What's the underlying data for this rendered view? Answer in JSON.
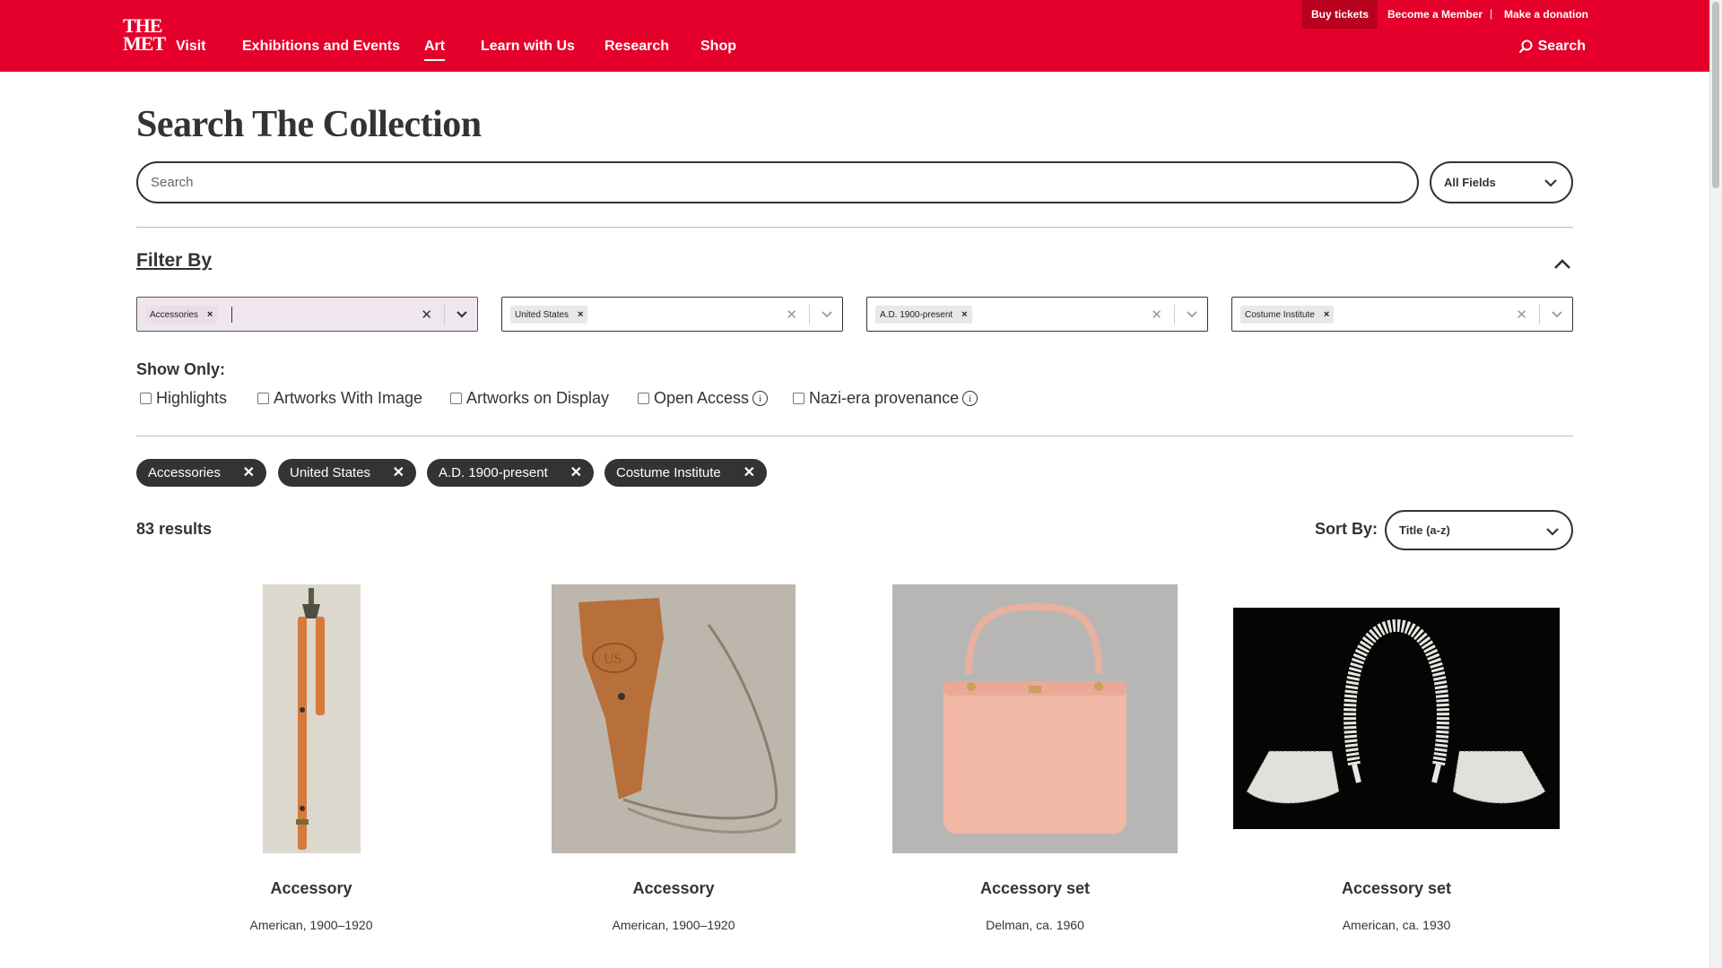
{
  "brand": {
    "logo_line1": "THE",
    "logo_line2": "MET",
    "color": "#e4002b"
  },
  "utility": {
    "buy": "Buy tickets",
    "member": "Become a Member",
    "sep": "|",
    "donate": "Make a donation"
  },
  "nav": {
    "visit": "Visit",
    "exhibitions": "Exhibitions and Events",
    "art": "Art",
    "learn": "Learn with Us",
    "research": "Research",
    "shop": "Shop",
    "search": "Search"
  },
  "page_title": "Search The Collection",
  "search": {
    "placeholder": "Search",
    "field": "All Fields"
  },
  "filter": {
    "heading": "Filter By",
    "selects": [
      {
        "value": "Accessories"
      },
      {
        "value": "United States"
      },
      {
        "value": "A.D. 1900-present"
      },
      {
        "value": "Costume Institute"
      }
    ]
  },
  "show_only": {
    "heading": "Show Only:",
    "options": [
      "Highlights",
      "Artworks With Image",
      "Artworks on Display",
      "Open Access",
      "Nazi-era provenance"
    ]
  },
  "active_filters": [
    "Accessories",
    "United States",
    "A.D. 1900-present",
    "Costume Institute"
  ],
  "results": {
    "count_text": "83 results",
    "sort_label": "Sort By:",
    "sort_value": "Title (a-z)"
  },
  "cards": [
    {
      "title": "Accessory",
      "sub": "American, 1900–1920"
    },
    {
      "title": "Accessory",
      "sub": "American, 1900–1920"
    },
    {
      "title": "Accessory set",
      "sub": "Delman, ca. 1960"
    },
    {
      "title": "Accessory set",
      "sub": "American, ca. 1930"
    }
  ]
}
